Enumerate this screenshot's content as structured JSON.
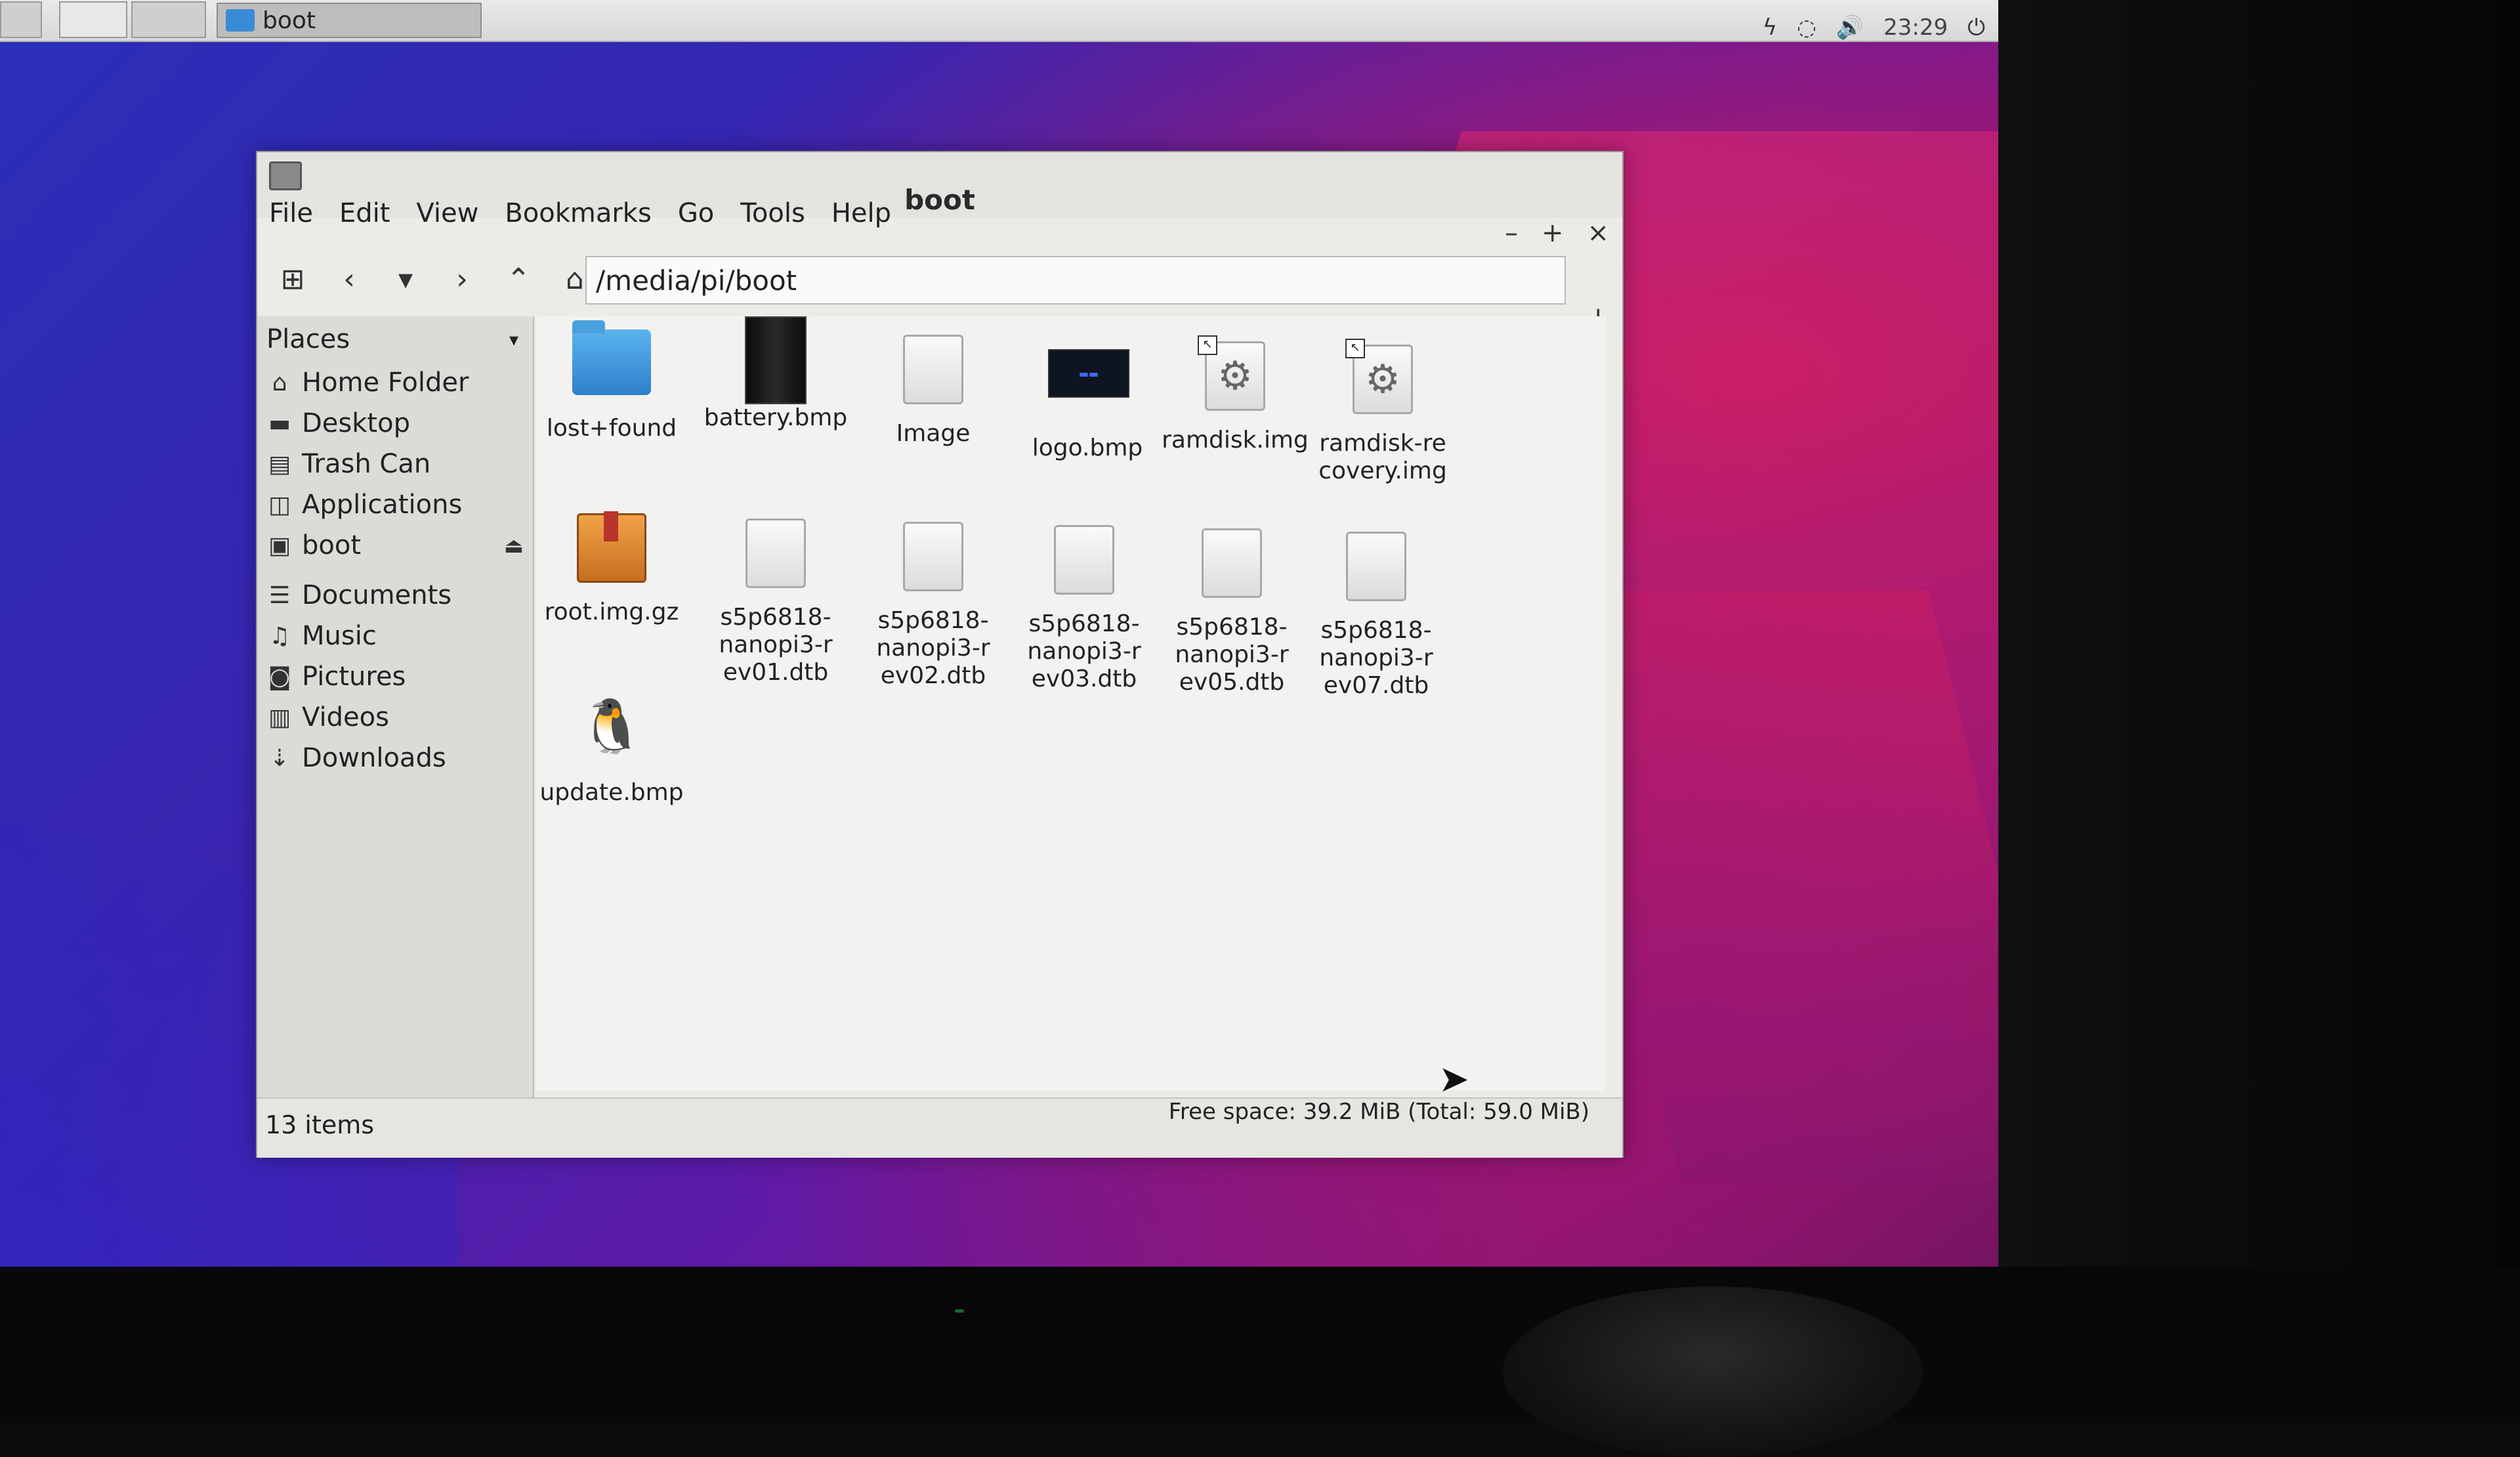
{
  "taskbar": {
    "task_label": "boot",
    "clock": "23:29"
  },
  "window": {
    "title": "boot",
    "menu": [
      "File",
      "Edit",
      "View",
      "Bookmarks",
      "Go",
      "Tools",
      "Help"
    ],
    "controls": {
      "minimize": "–",
      "maximize": "+",
      "close": "×"
    },
    "path": "/media/pi/boot"
  },
  "sidebar": {
    "header": "Places",
    "items": [
      {
        "label": "Home Folder",
        "icon": "home-icon"
      },
      {
        "label": "Desktop",
        "icon": "desktop-icon"
      },
      {
        "label": "Trash Can",
        "icon": "trash-icon"
      },
      {
        "label": "Applications",
        "icon": "applications-icon"
      },
      {
        "label": "boot",
        "icon": "drive-icon"
      },
      {
        "label": "Documents",
        "icon": "documents-icon"
      },
      {
        "label": "Music",
        "icon": "music-icon"
      },
      {
        "label": "Pictures",
        "icon": "pictures-icon"
      },
      {
        "label": "Videos",
        "icon": "videos-icon"
      },
      {
        "label": "Downloads",
        "icon": "downloads-icon"
      }
    ]
  },
  "files": [
    {
      "name": "lost+found",
      "icon": "folder-icon"
    },
    {
      "name": "battery.bmp",
      "icon": "image-icon"
    },
    {
      "name": "Image",
      "icon": "generic-file-icon"
    },
    {
      "name": "logo.bmp",
      "icon": "image-icon"
    },
    {
      "name": "ramdisk.img",
      "icon": "disk-image-icon"
    },
    {
      "name": "ramdisk-recovery.img",
      "icon": "disk-image-icon"
    },
    {
      "name": "root.img.gz",
      "icon": "archive-icon"
    },
    {
      "name": "s5p6818-nanopi3-rev01.dtb",
      "icon": "generic-file-icon"
    },
    {
      "name": "s5p6818-nanopi3-rev02.dtb",
      "icon": "generic-file-icon"
    },
    {
      "name": "s5p6818-nanopi3-rev03.dtb",
      "icon": "generic-file-icon"
    },
    {
      "name": "s5p6818-nanopi3-rev05.dtb",
      "icon": "generic-file-icon"
    },
    {
      "name": "s5p6818-nanopi3-rev07.dtb",
      "icon": "generic-file-icon"
    },
    {
      "name": "update.bmp",
      "icon": "image-icon"
    }
  ],
  "status": {
    "items": "13 items",
    "free_space": "Free space: 39.2 MiB (Total: 59.0 MiB)"
  },
  "colors": {
    "folder": "#3a8bd6",
    "desktop_blue": "#2a2fb8",
    "desktop_magenta": "#c0185a"
  }
}
